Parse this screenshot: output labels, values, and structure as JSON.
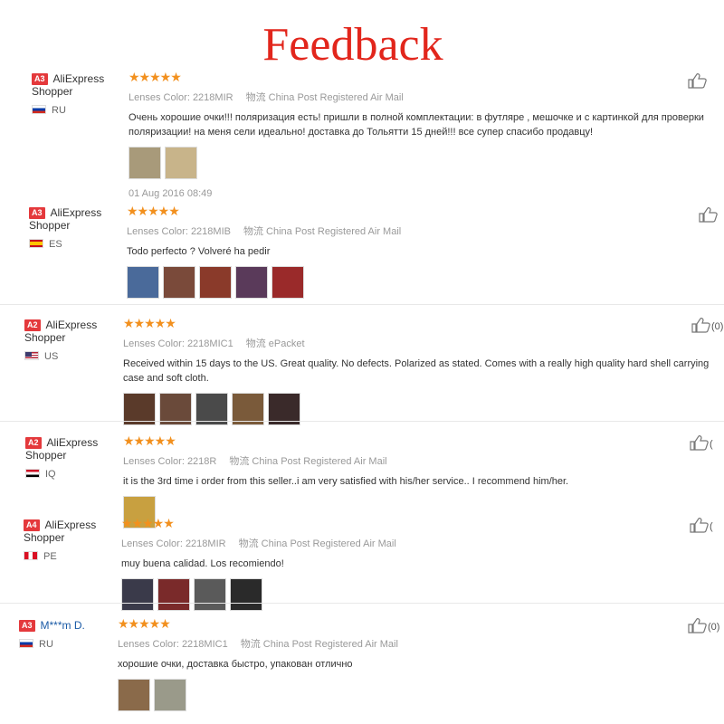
{
  "header": {
    "title": "Feedback"
  },
  "reviews": [
    {
      "badge": "A3",
      "name": "AliExpress Shopper",
      "country": "RU",
      "stars": "★★★★★",
      "color_label": "Lenses Color:",
      "color_value": "2218MIR",
      "shipping_label": "物流",
      "shipping_value": "China Post Registered Air Mail",
      "text": "Очень хорошие очки!!! поляризация есть! пришли в полной комплектации: в футляре , мешочке и с картинкой для проверки поляризации! на меня сели идеально! доставка до Тольятти 15 дней!!! все супер спасибо продавцу!",
      "date": "01 Aug 2016 08:49",
      "likes": "",
      "thumb_colors": [
        "#a89a7a",
        "#c8b48a"
      ]
    },
    {
      "badge": "A3",
      "name": "AliExpress Shopper",
      "country": "ES",
      "stars": "★★★★★",
      "color_label": "Lenses Color:",
      "color_value": "2218MIB",
      "shipping_label": "物流",
      "shipping_value": "China Post Registered Air Mail",
      "text": "Todo perfecto ? Volveré ha pedir",
      "date": "",
      "likes": "",
      "thumb_colors": [
        "#4a6a9a",
        "#7a4a3a",
        "#8a3a2a",
        "#5a3a5a",
        "#9a2a2a"
      ]
    },
    {
      "badge": "A2",
      "name": "AliExpress Shopper",
      "country": "US",
      "stars": "★★★★★",
      "color_label": "Lenses Color:",
      "color_value": "2218MIC1",
      "shipping_label": "物流",
      "shipping_value": "ePacket",
      "text": "Received within 15 days to the US. Great quality. No defects. Polarized as stated. Comes with a really high quality hard shell carrying case and soft cloth.",
      "date": "",
      "likes": "(0)",
      "thumb_colors": [
        "#5a3a2a",
        "#6a4a3a",
        "#4a4a4a",
        "#7a5a3a",
        "#3a2a2a"
      ]
    },
    {
      "badge": "A2",
      "name": "AliExpress Shopper",
      "country": "IQ",
      "stars": "★★★★★",
      "color_label": "Lenses Color:",
      "color_value": "2218R",
      "shipping_label": "物流",
      "shipping_value": "China Post Registered Air Mail",
      "text": "it is the 3rd time i order from this seller..i am very satisfied with his/her service.. I recommend him/her.",
      "date": "",
      "likes": "(",
      "thumb_colors": [
        "#c8a040"
      ]
    },
    {
      "badge": "A4",
      "name": "AliExpress Shopper",
      "country": "PE",
      "stars": "★★★★★",
      "color_label": "Lenses Color:",
      "color_value": "2218MIR",
      "shipping_label": "物流",
      "shipping_value": "China Post Registered Air Mail",
      "text": "muy buena calidad. Los recomiendo!",
      "date": "",
      "likes": "(",
      "thumb_colors": [
        "#3a3a4a",
        "#7a2a2a",
        "#5a5a5a",
        "#2a2a2a"
      ]
    },
    {
      "badge": "A3",
      "name": "M***m D.",
      "country": "RU",
      "stars": "★★★★★",
      "color_label": "Lenses Color:",
      "color_value": "2218MIC1",
      "shipping_label": "物流",
      "shipping_value": "China Post Registered Air Mail",
      "text": "хорошие очки, доставка быстро, упакован отлично",
      "date": "",
      "likes": "(0)",
      "thumb_colors": [
        "#8a6a4a",
        "#9a9a8a"
      ]
    }
  ]
}
